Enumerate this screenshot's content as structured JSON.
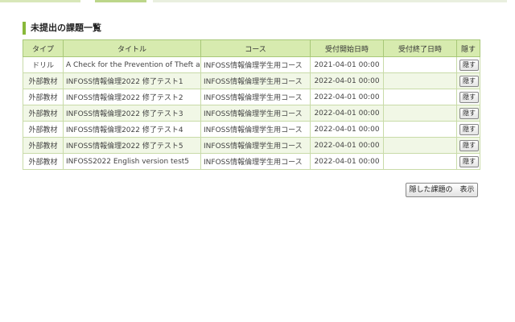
{
  "section": {
    "title": "未提出の課題一覧"
  },
  "table": {
    "headers": {
      "type": "タイプ",
      "title": "タイトル",
      "course": "コース",
      "start": "受付開始日時",
      "end": "受付終了日時",
      "hide": "隠す"
    },
    "rows": [
      {
        "type": "ドリル",
        "title": "A Check for the Prevention of Theft and",
        "course": "INFOSS情報倫理学生用コース",
        "start": "2021-04-01 00:00",
        "end": "",
        "hide_label": "隠す"
      },
      {
        "type": "外部教材",
        "title": "INFOSS情報倫理2022 修了テスト1",
        "course": "INFOSS情報倫理学生用コース",
        "start": "2022-04-01 00:00",
        "end": "",
        "hide_label": "隠す"
      },
      {
        "type": "外部教材",
        "title": "INFOSS情報倫理2022 修了テスト2",
        "course": "INFOSS情報倫理学生用コース",
        "start": "2022-04-01 00:00",
        "end": "",
        "hide_label": "隠す"
      },
      {
        "type": "外部教材",
        "title": "INFOSS情報倫理2022 修了テスト3",
        "course": "INFOSS情報倫理学生用コース",
        "start": "2022-04-01 00:00",
        "end": "",
        "hide_label": "隠す"
      },
      {
        "type": "外部教材",
        "title": "INFOSS情報倫理2022 修了テスト4",
        "course": "INFOSS情報倫理学生用コース",
        "start": "2022-04-01 00:00",
        "end": "",
        "hide_label": "隠す"
      },
      {
        "type": "外部教材",
        "title": "INFOSS情報倫理2022 修了テスト5",
        "course": "INFOSS情報倫理学生用コース",
        "start": "2022-04-01 00:00",
        "end": "",
        "hide_label": "隠す"
      },
      {
        "type": "外部教材",
        "title": "INFOSS2022 English version test5",
        "course": "INFOSS情報倫理学生用コース",
        "start": "2022-04-01 00:00",
        "end": "",
        "hide_label": "隠す"
      }
    ]
  },
  "actions": {
    "show_hidden_label": "隠した課題の　表示"
  },
  "colors": {
    "accent": "#88b83a",
    "header_bg": "#d7ebaf",
    "row_alt_bg": "#f1f7e6"
  }
}
